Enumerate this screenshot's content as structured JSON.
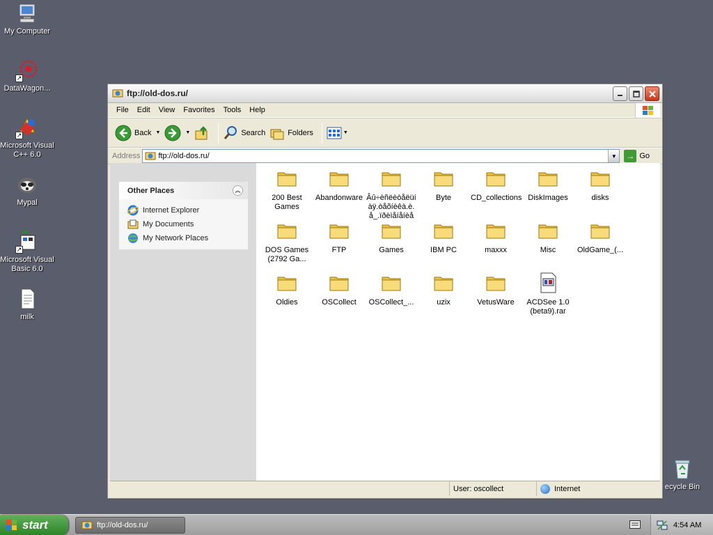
{
  "desktop": {
    "icons": [
      {
        "label": "My Computer",
        "icon": "my-computer-icon"
      },
      {
        "label": "DataWagon...",
        "icon": "datawagon-icon"
      },
      {
        "label": "Microsoft Visual\nC++ 6.0",
        "icon": "visual-cpp-icon"
      },
      {
        "label": "Mypal",
        "icon": "mypal-icon"
      },
      {
        "label": "Microsoft Visual\nBasic 6.0",
        "icon": "visual-basic-icon"
      },
      {
        "label": "milk",
        "icon": "text-file-icon"
      },
      {
        "label": "ecycle Bin",
        "icon": "recycle-bin-icon"
      }
    ]
  },
  "window": {
    "title": "ftp://old-dos.ru/",
    "menu": [
      "File",
      "Edit",
      "View",
      "Favorites",
      "Tools",
      "Help"
    ],
    "toolbar": {
      "back": "Back",
      "search": "Search",
      "folders": "Folders"
    },
    "address": {
      "label": "Address",
      "value": "ftp://old-dos.ru/",
      "go": "Go"
    },
    "taskpane": {
      "title": "Other Places",
      "items": [
        "Internet Explorer",
        "My Documents",
        "My Network Places"
      ]
    },
    "files": [
      {
        "name": "200 Best\nGames",
        "type": "folder"
      },
      {
        "name": "Abandonware",
        "type": "folder"
      },
      {
        "name": "Âû÷èñëèòåëüí\nàÿ.òåõíèêà.è.\nå_.ïðèìåíåíèå",
        "type": "folder"
      },
      {
        "name": "Byte",
        "type": "folder"
      },
      {
        "name": "CD_collections",
        "type": "folder"
      },
      {
        "name": "DiskImages",
        "type": "folder"
      },
      {
        "name": "disks",
        "type": "folder"
      },
      {
        "name": "DOS Games\n(2792 Ga...",
        "type": "folder"
      },
      {
        "name": "FTP",
        "type": "folder"
      },
      {
        "name": "Games",
        "type": "folder"
      },
      {
        "name": "IBM PC",
        "type": "folder"
      },
      {
        "name": "maxxx",
        "type": "folder"
      },
      {
        "name": "Misc",
        "type": "folder"
      },
      {
        "name": "OldGame_(...",
        "type": "folder"
      },
      {
        "name": "Oldies",
        "type": "folder"
      },
      {
        "name": "OSCollect",
        "type": "folder"
      },
      {
        "name": "OSCollect_...",
        "type": "folder"
      },
      {
        "name": "uzix",
        "type": "folder"
      },
      {
        "name": "VetusWare",
        "type": "folder"
      },
      {
        "name": "ACDSee 1.0\n(beta9).rar",
        "type": "archive"
      }
    ],
    "status": {
      "user": "User: oscollect",
      "zone": "Internet"
    }
  },
  "taskbar": {
    "start": "start",
    "task": "ftp://old-dos.ru/",
    "time": "4:54 AM"
  }
}
